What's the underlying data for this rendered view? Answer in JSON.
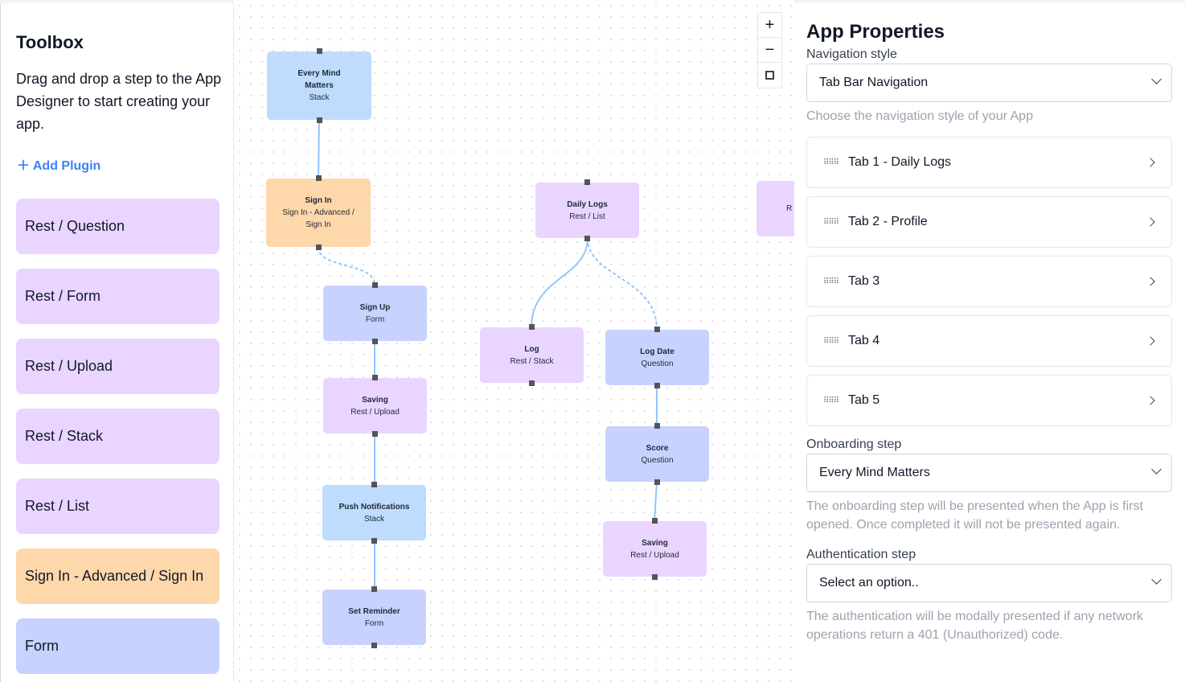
{
  "toolbox": {
    "title": "Toolbox",
    "description": "Drag and drop a step to the App Designer to start creating your app.",
    "add_plugin": "Add Plugin",
    "items": [
      {
        "label": "Rest / Question",
        "color": "#e9d5ff"
      },
      {
        "label": "Rest / Form",
        "color": "#e9d5ff"
      },
      {
        "label": "Rest / Upload",
        "color": "#e9d5ff"
      },
      {
        "label": "Rest / Stack",
        "color": "#e9d5ff"
      },
      {
        "label": "Rest / List",
        "color": "#e9d5ff"
      },
      {
        "label": "Sign In - Advanced / Sign In",
        "color": "#fed7aa"
      },
      {
        "label": "Form",
        "color": "#c7d2fe"
      }
    ]
  },
  "canvas": {
    "zoom_in": "+",
    "zoom_out": "−",
    "fit_icon": "fit-view-icon",
    "nodes": [
      {
        "title": "Every Mind Matters",
        "type": "Stack"
      },
      {
        "title": "Sign In",
        "type": "Sign In - Advanced / Sign In"
      },
      {
        "title": "Sign Up",
        "type": "Form"
      },
      {
        "title": "Saving",
        "type": "Rest / Upload"
      },
      {
        "title": "Push Notifications",
        "type": "Stack"
      },
      {
        "title": "Set Reminder",
        "type": "Form"
      },
      {
        "title": "Daily Logs",
        "type": "Rest / List"
      },
      {
        "title": "Log",
        "type": "Rest / Stack"
      },
      {
        "title": "Log Date",
        "type": "Question"
      },
      {
        "title": "Score",
        "type": "Question"
      },
      {
        "title": "Saving",
        "type": "Rest / Upload"
      },
      {
        "title": "",
        "type": "R"
      }
    ]
  },
  "properties": {
    "title": "App Properties",
    "navigation_label": "Navigation style",
    "navigation_value": "Tab Bar Navigation",
    "navigation_hint": "Choose the navigation style of your App",
    "tabs": [
      "Tab 1 - Daily Logs",
      "Tab 2 - Profile",
      "Tab 3",
      "Tab 4",
      "Tab 5"
    ],
    "onboarding_label": "Onboarding step",
    "onboarding_value": "Every Mind Matters",
    "onboarding_hint": "The onboarding step will be presented when the App is first opened. Once completed it will not be presented again.",
    "auth_label": "Authentication step",
    "auth_value": "Select an option..",
    "auth_hint": "The authentication will be modally presented if any network operations return a 401 (Unauthorized) code."
  }
}
